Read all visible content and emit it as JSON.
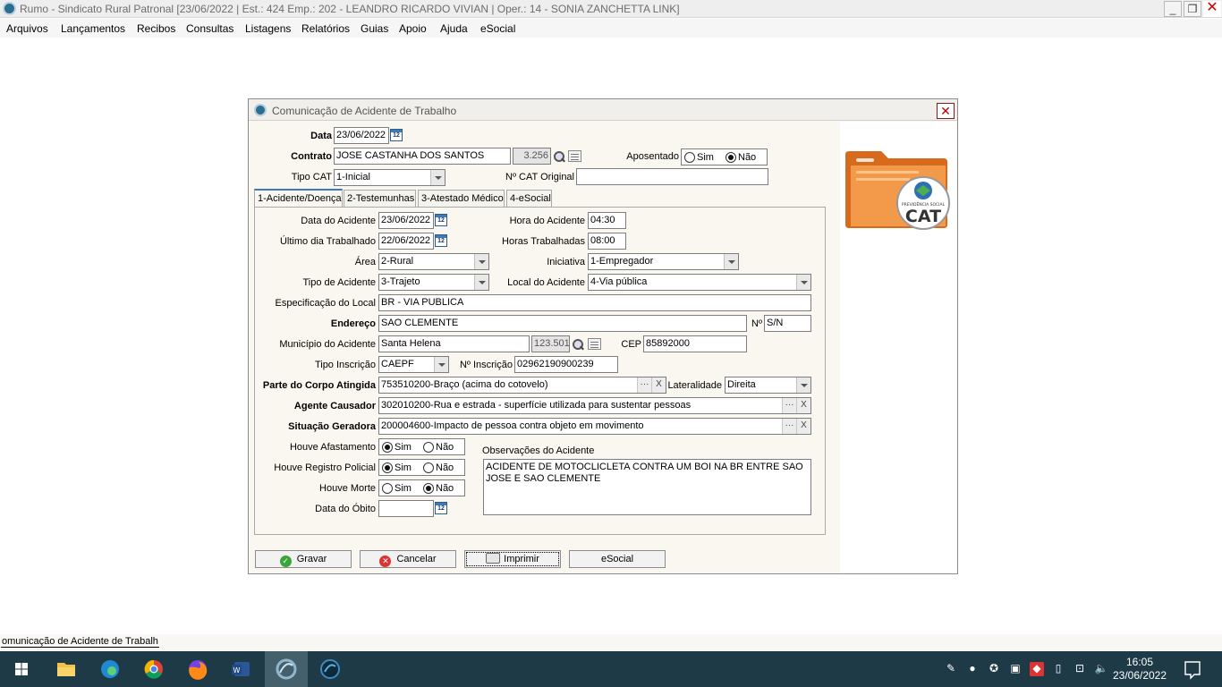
{
  "window": {
    "title": "Rumo - Sindicato Rural Patronal [23/06/2022 | Est.: 424 Emp.: 202 - LEANDRO RICARDO VIVIAN | Oper.: 14 - SONIA ZANCHETTA LINK]",
    "minimize": "_",
    "restore": "❐",
    "close": "✕"
  },
  "menu": [
    "Arquivos",
    "Lançamentos",
    "Recibos",
    "Consultas",
    "Listagens",
    "Relatórios",
    "Guias",
    "Apoio",
    "Ajuda",
    "eSocial"
  ],
  "dialog": {
    "title": "Comunicação de Acidente de Trabalho",
    "close": "✕",
    "logo_text": "CAT",
    "logo_small": "PREVIDÊNCIA SOCIAL",
    "data_label": "Data",
    "data_value": "23/06/2022",
    "contrato_label": "Contrato",
    "contrato_value": "JOSE CASTANHA DOS SANTOS",
    "contrato_code": "3.256",
    "aposentado_label": "Aposentado",
    "aposentado_sim": "Sim",
    "aposentado_nao": "Não",
    "tipo_cat_label": "Tipo CAT",
    "tipo_cat_value": "1-Inicial",
    "cat_original_label": "Nº CAT Original",
    "cat_original_value": "",
    "tabs": [
      "1-Acidente/Doença",
      "2-Testemunhas",
      "3-Atestado Médico",
      "4-eSocial"
    ],
    "cal_text": "12",
    "fields": {
      "data_acidente_label": "Data do Acidente",
      "data_acidente": "23/06/2022",
      "hora_acidente_label": "Hora do Acidente",
      "hora_acidente": "04:30",
      "ultimo_dia_label": "Último dia Trabalhado",
      "ultimo_dia": "22/06/2022",
      "horas_trab_label": "Horas Trabalhadas",
      "horas_trab": "08:00",
      "area_label": "Área",
      "area": "2-Rural",
      "iniciativa_label": "Iniciativa",
      "iniciativa": "1-Empregador",
      "tipo_acidente_label": "Tipo de Acidente",
      "tipo_acidente": "3-Trajeto",
      "local_acidente_label": "Local do Acidente",
      "local_acidente": "4-Via pública",
      "espec_local_label": "Especificação do Local",
      "espec_local": "BR - VIA PUBLICA",
      "endereco_label": "Endereço",
      "endereco": "SAO CLEMENTE",
      "numero_label": "Nº",
      "numero": "S/N",
      "municipio_label": "Município do Acidente",
      "municipio": "Santa Helena",
      "municipio_code": "123.501",
      "cep_label": "CEP",
      "cep": "85892000",
      "tipo_insc_label": "Tipo Inscrição",
      "tipo_insc": "CAEPF",
      "n_insc_label": "Nº Inscrição",
      "n_insc": "02962190900239",
      "parte_corpo_label": "Parte do Corpo Atingida",
      "parte_corpo": "753510200-Braço (acima do cotovelo)",
      "lateralidade_label": "Lateralidade",
      "lateralidade": "Direita",
      "agente_label": "Agente Causador",
      "agente": "302010200-Rua e estrada - superfície utilizada para sustentar pessoas",
      "situacao_label": "Situação Geradora",
      "situacao": "200004600-Impacto de pessoa contra objeto em movimento",
      "afastamento_label": "Houve Afastamento",
      "registro_label": "Houve Registro Policial",
      "morte_label": "Houve Morte",
      "obito_label": "Data do Óbito",
      "obito": "",
      "sim": "Sim",
      "nao": "Não",
      "obs_label": "Observações do Acidente",
      "obs": "ACIDENTE DE MOTOCLICLETA CONTRA UM BOI NA BR ENTRE SAO JOSE E SAO CLEMENTE",
      "dots": "···",
      "x": "X"
    },
    "buttons": {
      "gravar": "Gravar",
      "cancelar": "Cancelar",
      "imprimir": "Imprimir",
      "esocial": "eSocial"
    }
  },
  "status_text": "omunicação de Acidente de Trabalh",
  "taskbar": {
    "time": "16:05",
    "date": "23/06/2022"
  }
}
